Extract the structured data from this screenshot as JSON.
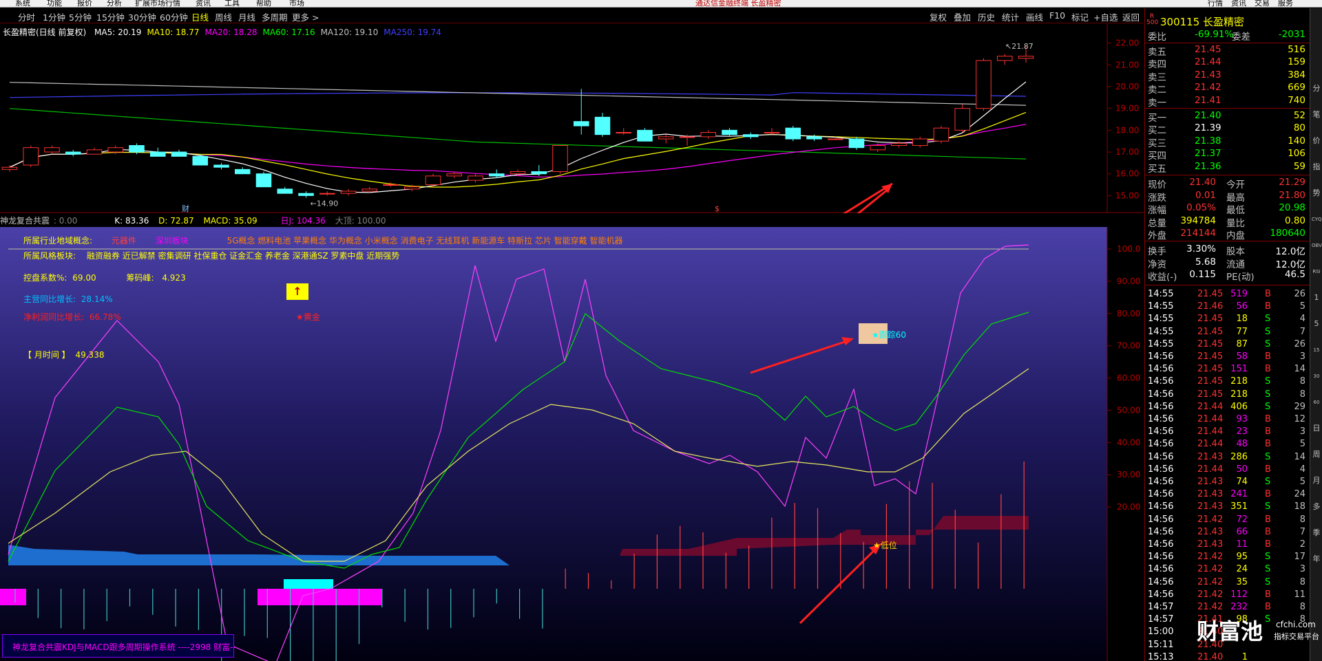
{
  "menu": {
    "items": [
      "系统",
      "功能",
      "报价",
      "分析",
      "扩展市场行情",
      "资讯",
      "工具",
      "帮助",
      "市场"
    ],
    "center_title": "通达信金融终端  长盈精密",
    "right_items": [
      "行情",
      "资讯",
      "交易",
      "服务"
    ]
  },
  "toolbar": {
    "periods": [
      "分时",
      "1分钟",
      "5分钟",
      "15分钟",
      "30分钟",
      "60分钟",
      "日线",
      "周线",
      "月线",
      "多周期",
      "更多 >"
    ],
    "active_period": "日线",
    "right_tools": [
      "复权",
      "叠加",
      "历史",
      "统计",
      "画线",
      "F10",
      "标记",
      "+自选",
      "返回"
    ]
  },
  "kline": {
    "title": "长盈精密(日线 前复权)",
    "ma": [
      {
        "label": "MA5: 20.19",
        "color": "#ffffff"
      },
      {
        "label": "MA10: 18.77",
        "color": "#ffff00"
      },
      {
        "label": "MA20: 18.28",
        "color": "#ff00ff"
      },
      {
        "label": "MA60: 17.16",
        "color": "#00ff00"
      },
      {
        "label": "MA120: 19.10",
        "color": "#c0c0c0"
      },
      {
        "label": "MA250: 19.74",
        "color": "#4040ff"
      }
    ],
    "high_label": "21.87",
    "low_label": "14.90",
    "marker_cai": "财",
    "marker_s": "$",
    "y_ticks": [
      "22.00",
      "21.00",
      "20.00",
      "19.00",
      "18.00",
      "17.00",
      "16.00",
      "15.00"
    ]
  },
  "chart_data": {
    "type": "candlestick",
    "ylim": [
      14.6,
      22.4
    ],
    "candles": [
      [
        16.2,
        16.4,
        16.1,
        16.3
      ],
      [
        16.4,
        17.3,
        16.3,
        17.2
      ],
      [
        17.0,
        17.3,
        16.9,
        17.2
      ],
      [
        17.0,
        17.1,
        16.8,
        16.9
      ],
      [
        16.9,
        17.2,
        16.9,
        17.1
      ],
      [
        17.0,
        17.3,
        16.9,
        17.2
      ],
      [
        17.3,
        17.4,
        16.9,
        17.0
      ],
      [
        17.0,
        17.2,
        16.8,
        16.8
      ],
      [
        17.0,
        17.1,
        16.8,
        16.8
      ],
      [
        16.8,
        16.9,
        16.4,
        16.4
      ],
      [
        16.4,
        16.5,
        16.2,
        16.3
      ],
      [
        16.2,
        16.3,
        16.0,
        16.0
      ],
      [
        16.0,
        16.1,
        15.4,
        15.4
      ],
      [
        15.3,
        15.4,
        15.1,
        15.1
      ],
      [
        15.1,
        15.2,
        14.9,
        15.0
      ],
      [
        15.1,
        15.2,
        15.0,
        15.1
      ],
      [
        15.1,
        15.3,
        15.0,
        15.2
      ],
      [
        15.2,
        15.4,
        15.1,
        15.3
      ],
      [
        15.5,
        15.6,
        15.4,
        15.5
      ],
      [
        15.3,
        15.5,
        15.2,
        15.4
      ],
      [
        15.5,
        16.0,
        15.4,
        15.9
      ],
      [
        15.9,
        16.1,
        15.8,
        16.0
      ],
      [
        15.7,
        16.0,
        15.6,
        15.9
      ],
      [
        16.0,
        16.2,
        15.8,
        15.9
      ],
      [
        16.0,
        16.2,
        15.9,
        16.1
      ],
      [
        16.1,
        16.4,
        15.9,
        16.0
      ],
      [
        16.1,
        17.3,
        16.0,
        17.3
      ],
      [
        18.4,
        19.9,
        17.8,
        18.2
      ],
      [
        18.6,
        18.8,
        17.7,
        17.8
      ],
      [
        17.9,
        18.1,
        17.8,
        17.9
      ],
      [
        18.0,
        18.1,
        17.5,
        17.5
      ],
      [
        17.6,
        17.8,
        17.4,
        17.7
      ],
      [
        17.7,
        17.8,
        17.3,
        17.7
      ],
      [
        17.7,
        18.0,
        17.6,
        17.9
      ],
      [
        18.0,
        18.1,
        17.7,
        17.8
      ],
      [
        17.8,
        17.9,
        17.6,
        17.7
      ],
      [
        17.9,
        18.1,
        17.8,
        17.9
      ],
      [
        18.1,
        18.2,
        17.5,
        17.6
      ],
      [
        17.7,
        17.8,
        17.5,
        17.6
      ],
      [
        17.6,
        17.7,
        17.6,
        17.6
      ],
      [
        17.6,
        17.7,
        17.1,
        17.2
      ],
      [
        17.1,
        17.4,
        17.0,
        17.3
      ],
      [
        17.3,
        17.5,
        17.2,
        17.4
      ],
      [
        17.3,
        17.7,
        17.2,
        17.6
      ],
      [
        17.5,
        18.2,
        17.4,
        18.1
      ],
      [
        18.0,
        19.2,
        17.9,
        19.0
      ],
      [
        19.0,
        21.3,
        18.9,
        21.2
      ],
      [
        21.2,
        21.5,
        21.0,
        21.4
      ],
      [
        21.3,
        21.87,
        21.1,
        21.4
      ]
    ]
  },
  "indicator": {
    "name": "神龙复合共震",
    "zero": ": 0.00",
    "k": "K: 83.36",
    "d": "D: 72.87",
    "macd": "MACD: 35.09",
    "j": "日J: 104.36",
    "dj": "大顶: 100.00",
    "y_ticks": [
      "100.0",
      "90.00",
      "80.00",
      "70.00",
      "60.00",
      "50.00",
      "40.00",
      "30.00",
      "20.00"
    ]
  },
  "info": {
    "concept_label": "所属行业地域概念:",
    "concept_v1": "元器件",
    "concept_v2": "深圳板块",
    "concepts": "5G概念 燃料电池 苹果概念 华为概念 小米概念 消费电子 无线耳机 新能源车 特斯拉 芯片 智能穿戴 智能机器",
    "style_label": "所属风格板块:",
    "styles": "融资融券 近已解禁 密集调研 社保重仓 证金汇金 养老金 深港通SZ 罗素中盘 近期强势",
    "control_label": "控盘系数%:",
    "control_value": "69.00",
    "chip_label": "筹码峰:",
    "chip_value": "4.923",
    "revenue_label": "主营同比增长:",
    "revenue_value": "28.14%",
    "profit_label": "净利润同比增长:",
    "profit_value": "66.78%",
    "month_label": "【 月时间 】",
    "month_value": "49.338",
    "gold_label": "★黄金",
    "track_label": "★跟踪60",
    "low_label": "★低位",
    "arrow": "↑"
  },
  "footer_note": "神龙复合共震KDJ与MACD跟多周期操作系统 ----2998 财富--",
  "quote": {
    "badge": "R 500",
    "code_name": "300115 长盈精密",
    "weibi_label": "委比",
    "weibi_value": "-69.91%",
    "weicha_label": "委差",
    "weicha_value": "-2031",
    "sell": [
      {
        "label": "卖五",
        "price": "21.45",
        "vol": "516"
      },
      {
        "label": "卖四",
        "price": "21.44",
        "vol": "159"
      },
      {
        "label": "卖三",
        "price": "21.43",
        "vol": "384"
      },
      {
        "label": "卖二",
        "price": "21.42",
        "vol": "669"
      },
      {
        "label": "卖一",
        "price": "21.41",
        "vol": "740"
      }
    ],
    "buy": [
      {
        "label": "买一",
        "price": "21.40",
        "vol": "52"
      },
      {
        "label": "买二",
        "price": "21.39",
        "vol": "80"
      },
      {
        "label": "买三",
        "price": "21.38",
        "vol": "140"
      },
      {
        "label": "买四",
        "price": "21.37",
        "vol": "106"
      },
      {
        "label": "买五",
        "price": "21.36",
        "vol": "59"
      }
    ],
    "stats": [
      {
        "l1": "现价",
        "v1": "21.40",
        "l2": "今开",
        "v2": "21.29"
      },
      {
        "l1": "涨跌",
        "v1": "0.01",
        "l2": "最高",
        "v2": "21.80"
      },
      {
        "l1": "涨幅",
        "v1": "0.05%",
        "l2": "最低",
        "v2": "20.98"
      },
      {
        "l1": "总量",
        "v1": "394784",
        "l2": "量比",
        "v2": "0.80"
      },
      {
        "l1": "外盘",
        "v1": "214144",
        "l2": "内盘",
        "v2": "180640"
      },
      {
        "l1": "换手",
        "v1": "3.30%",
        "l2": "股本",
        "v2": "12.0亿"
      },
      {
        "l1": "净资",
        "v1": "5.68",
        "l2": "流通",
        "v2": "12.0亿"
      },
      {
        "l1": "收益(-)",
        "v1": "0.115",
        "l2": "PE(动)",
        "v2": "46.5"
      }
    ],
    "trades": [
      [
        "14:55",
        "21.45",
        "519",
        "B",
        "26"
      ],
      [
        "14:55",
        "21.46",
        "56",
        "B",
        "5"
      ],
      [
        "14:55",
        "21.45",
        "18",
        "S",
        "4"
      ],
      [
        "14:55",
        "21.45",
        "77",
        "S",
        "7"
      ],
      [
        "14:55",
        "21.45",
        "87",
        "S",
        "26"
      ],
      [
        "14:56",
        "21.45",
        "58",
        "B",
        "3"
      ],
      [
        "14:56",
        "21.45",
        "151",
        "B",
        "14"
      ],
      [
        "14:56",
        "21.45",
        "218",
        "S",
        "8"
      ],
      [
        "14:56",
        "21.45",
        "218",
        "S",
        "8"
      ],
      [
        "14:56",
        "21.44",
        "406",
        "S",
        "29"
      ],
      [
        "14:56",
        "21.44",
        "93",
        "B",
        "12"
      ],
      [
        "14:56",
        "21.44",
        "23",
        "B",
        "3"
      ],
      [
        "14:56",
        "21.44",
        "48",
        "B",
        "5"
      ],
      [
        "14:56",
        "21.43",
        "286",
        "S",
        "14"
      ],
      [
        "14:56",
        "21.44",
        "50",
        "B",
        "4"
      ],
      [
        "14:56",
        "21.43",
        "74",
        "S",
        "5"
      ],
      [
        "14:56",
        "21.43",
        "241",
        "B",
        "24"
      ],
      [
        "14:56",
        "21.43",
        "351",
        "S",
        "18"
      ],
      [
        "14:56",
        "21.42",
        "72",
        "B",
        "8"
      ],
      [
        "14:56",
        "21.43",
        "66",
        "B",
        "7"
      ],
      [
        "14:56",
        "21.43",
        "11",
        "B",
        "2"
      ],
      [
        "14:56",
        "21.42",
        "95",
        "S",
        "17"
      ],
      [
        "14:56",
        "21.42",
        "24",
        "S",
        "3"
      ],
      [
        "14:56",
        "21.42",
        "35",
        "S",
        "8"
      ],
      [
        "14:56",
        "21.42",
        "112",
        "B",
        "11"
      ],
      [
        "14:57",
        "21.42",
        "232",
        "B",
        "8"
      ],
      [
        "14:57",
        "21.41",
        "98",
        "S",
        "8"
      ],
      [
        "15:00",
        "21.40",
        "",
        "",
        ""
      ],
      [
        "15:11",
        "21.40",
        "",
        "",
        ""
      ],
      [
        "15:13",
        "21.40",
        "1",
        "",
        ""
      ]
    ]
  },
  "sidebar_labels": [
    "分",
    "笔",
    "价",
    "指",
    "势",
    "CYQ",
    "OBV",
    "RSI",
    "1",
    "5",
    "15",
    "30",
    "60",
    "日",
    "周",
    "月",
    "多",
    "季",
    "年"
  ],
  "watermark": {
    "main": "财富池",
    "site": "cfchi.com",
    "sub": "指标交易平台"
  }
}
